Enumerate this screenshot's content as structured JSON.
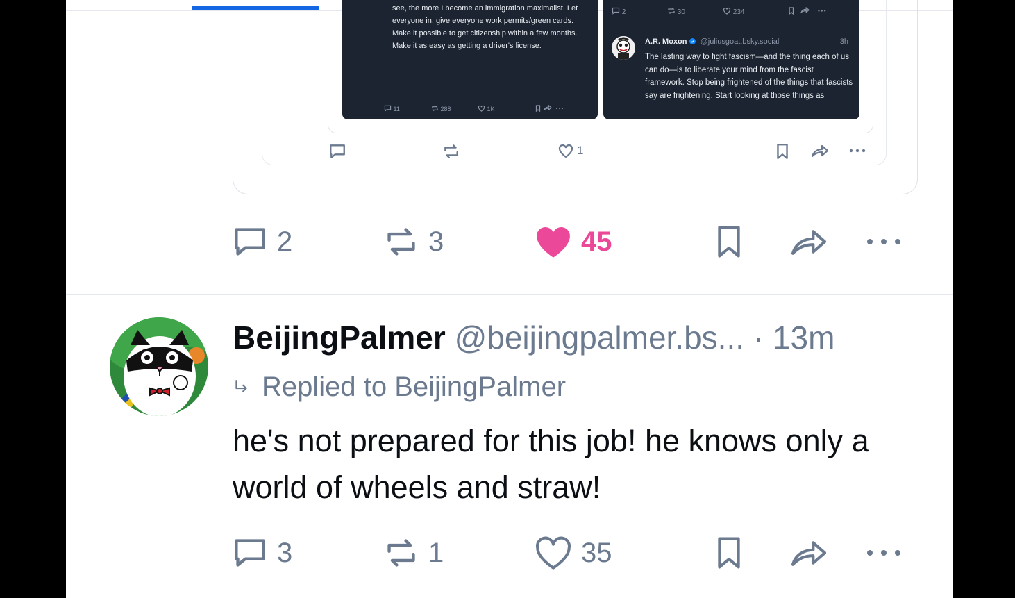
{
  "quoted_left": {
    "text": "see, the more I become an immigration maximalist. Let everyone in, give everyone work permits/green cards. Make it possible to get citizenship within a few months. Make it as easy as getting a driver's license.",
    "replies": "11",
    "reposts": "288",
    "likes": "1K"
  },
  "quoted_right": {
    "top_replies": "2",
    "top_reposts": "30",
    "top_likes": "234",
    "author": "A.R. Moxon",
    "handle": "@juliusgoat.bsky.social",
    "time": "3h",
    "text": "The lasting way to fight fascism—and the thing each of us can do—is to liberate your mind from the fascist framework. Stop being frightened of the things that fascists say are frightening. Start looking at those things as"
  },
  "embed_actions": {
    "likes": "1"
  },
  "post_actions": {
    "replies": "2",
    "reposts": "3",
    "likes": "45"
  },
  "reply_post": {
    "name": "BeijingPalmer",
    "handle": "@beijingpalmer.bs...",
    "dot": "·",
    "time": "13m",
    "replied_to": "Replied to BeijingPalmer",
    "text": "he's not prepared for this job! he knows only a world of wheels and straw!",
    "replies": "3",
    "reposts": "1",
    "likes": "35"
  },
  "colors": {
    "accent": "#1466e4",
    "like": "#ec4899",
    "muted": "#6b7a8f",
    "text": "#0b0f14"
  }
}
